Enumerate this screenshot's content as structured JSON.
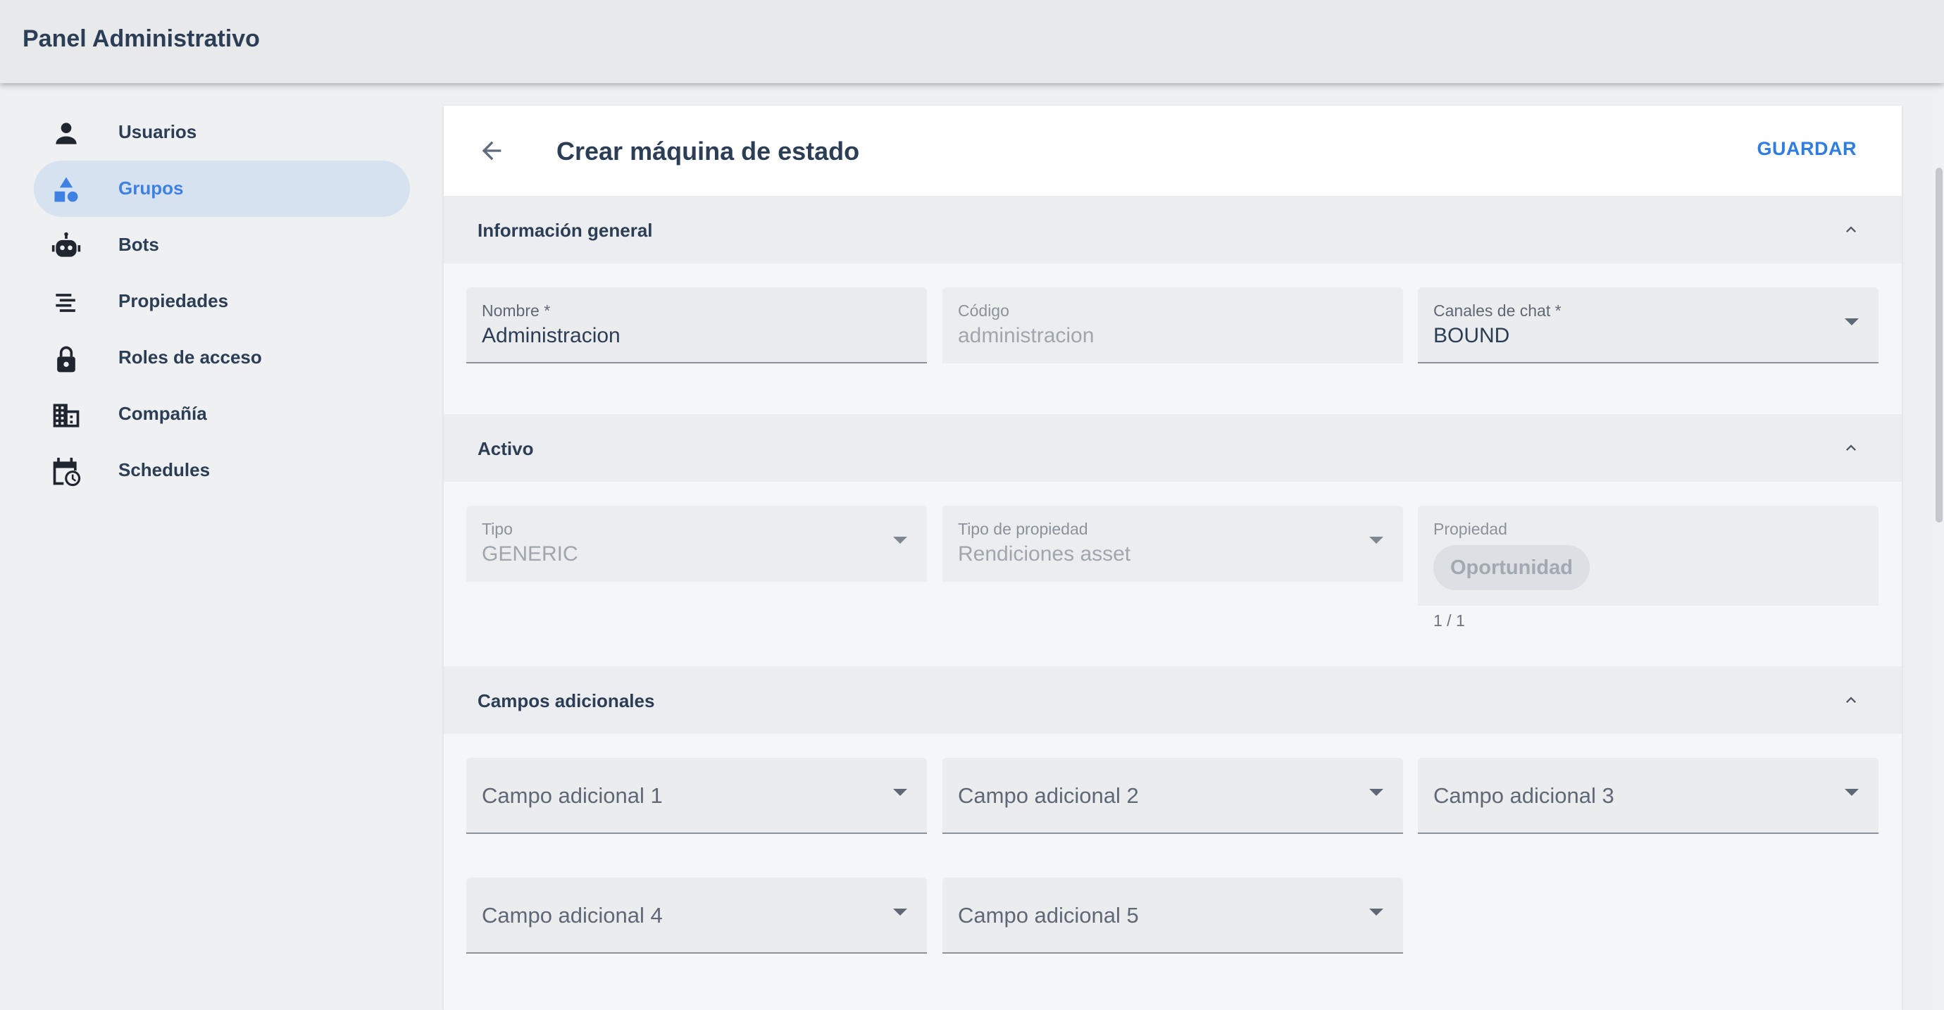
{
  "app": {
    "title": "Panel Administrativo"
  },
  "sidebar": {
    "items": [
      {
        "label": "Usuarios",
        "icon": "person-icon",
        "active": false
      },
      {
        "label": "Grupos",
        "icon": "shapes-icon",
        "active": true
      },
      {
        "label": "Bots",
        "icon": "robot-icon",
        "active": false
      },
      {
        "label": "Propiedades",
        "icon": "lines-icon",
        "active": false
      },
      {
        "label": "Roles de acceso",
        "icon": "lock-icon",
        "active": false
      },
      {
        "label": "Compañía",
        "icon": "building-icon",
        "active": false
      },
      {
        "label": "Schedules",
        "icon": "calendar-clock-icon",
        "active": false
      }
    ]
  },
  "page": {
    "title": "Crear máquina de estado",
    "save_label": "GUARDAR"
  },
  "sections": {
    "general": {
      "title": "Información general",
      "nombre": {
        "label": "Nombre *",
        "value": "Administracion"
      },
      "codigo": {
        "label": "Código",
        "value": "administracion"
      },
      "canales": {
        "label": "Canales de chat *",
        "value": "BOUND"
      }
    },
    "activo": {
      "title": "Activo",
      "tipo": {
        "label": "Tipo",
        "value": "GENERIC"
      },
      "tipo_propiedad": {
        "label": "Tipo de propiedad",
        "value": "Rendiciones asset"
      },
      "propiedad": {
        "label": "Propiedad",
        "chip": "Oportunidad",
        "counter": "1 / 1"
      }
    },
    "campos": {
      "title": "Campos adicionales",
      "fields": [
        "Campo adicional 1",
        "Campo adicional 2",
        "Campo adicional 3",
        "Campo adicional 4",
        "Campo adicional 5"
      ]
    }
  },
  "colors": {
    "accent": "#3f80e3",
    "active_bg": "#d6e2f0"
  }
}
